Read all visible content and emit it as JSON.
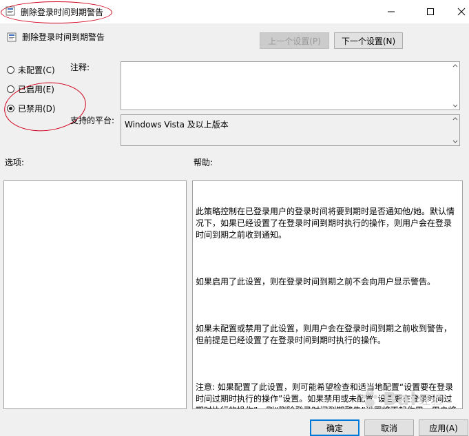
{
  "window": {
    "title": "删除登录时间到期警告",
    "minimize_icon": "minimize-icon",
    "maximize_icon": "maximize-icon",
    "close_icon": "close-icon"
  },
  "header": {
    "policy_name": "删除登录时间到期警告",
    "prev_button": "上一个设置(P)",
    "next_button": "下一个设置(N)"
  },
  "state": {
    "options": [
      {
        "label": "未配置(C)",
        "checked": false
      },
      {
        "label": "已启用(E)",
        "checked": false
      },
      {
        "label": "已禁用(D)",
        "checked": true
      }
    ]
  },
  "comment": {
    "label": "注释:",
    "value": ""
  },
  "supported": {
    "label": "支持的平台:",
    "value": "Windows Vista 及以上版本"
  },
  "options_panel": {
    "label": "选项:"
  },
  "help_panel": {
    "label": "帮助:",
    "paragraphs": [
      "此策略控制在已登录用户的登录时间将要到期时是否通知他/她。默认情况下，如果已经设置了在登录时间到期时执行的操作，则用户会在登录时间到期之前收到通知。",
      "如果启用了此设置，则在登录时间到期之前不会向用户显示警告。",
      "如果未配置或禁用了此设置，则用户会在登录时间到期之前收到警告，但前提是已经设置了在登录时间到期时执行的操作。",
      "注意: 如果配置了此设置，则可能希望检查和适当地配置“设置要在登录时间过期时执行的操作”设置。如果禁用或未配置“设置要在登录时间过期时执行的操作”，则“删除登录时间到期警告”设置将不起作用，用户将收不到有关登录时间到期的警告。"
    ]
  },
  "footer": {
    "ok_button": "确定",
    "cancel_button": "取消",
    "apply_button": "应用(A)"
  },
  "watermark": {
    "text": "Bai",
    "sub": "经验"
  },
  "colors": {
    "annotation": "#d0001a",
    "focus": "#0078d7"
  }
}
